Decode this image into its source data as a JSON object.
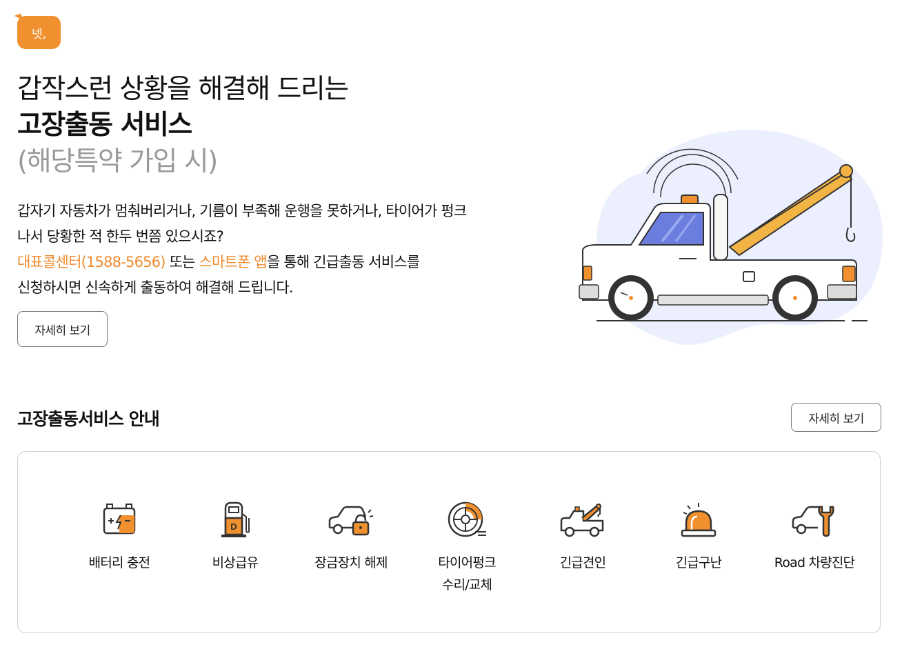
{
  "badge": {
    "text": "넷,"
  },
  "hero": {
    "line1": "갑작스런 상황을 해결해 드리는",
    "line2": "고장출동 서비스",
    "line3": "(해당특약 가입 시)"
  },
  "description": {
    "line1": "갑자기 자동차가 멈춰버리거나, 기름이 부족해 운행을 못하거나, 타이어가 펑크",
    "line2": "나서 당황한 적 한두 번쯤 있으시죠?",
    "highlight1": "대표콜센터(1588-5656)",
    "mid": " 또는 ",
    "highlight2": "스마트폰 앱",
    "rest": "을 통해 긴급출동 서비스를",
    "line4": "신청하시면 신속하게 출동하여 해결해 드립니다."
  },
  "hero_button": {
    "label": "자세히 보기"
  },
  "section": {
    "title": "고장출동서비스 안내",
    "button_label": "자세히 보기"
  },
  "services": [
    {
      "icon": "battery-icon",
      "label": "배터리 충전"
    },
    {
      "icon": "fuel-pump-icon",
      "label": "비상급유"
    },
    {
      "icon": "car-unlock-icon",
      "label": "장금장치 해제"
    },
    {
      "icon": "tire-icon",
      "label": "타이어펑크\n수리/교체"
    },
    {
      "icon": "tow-truck-icon",
      "label": "긴급견인"
    },
    {
      "icon": "siren-icon",
      "label": "긴급구난"
    },
    {
      "icon": "car-wrench-icon",
      "label": "Road 차량진단"
    }
  ],
  "colors": {
    "accent": "#ef8a2d",
    "muted": "#9a9a9a",
    "blob": "#eceffd",
    "window": "#6b7ee0"
  }
}
